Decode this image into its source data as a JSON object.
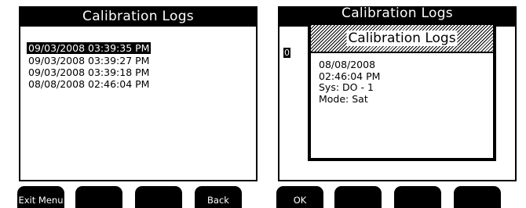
{
  "left_screen": {
    "title": "Calibration Logs",
    "entries": [
      "09/03/2008 03:39:35 PM",
      "09/03/2008 03:39:27 PM",
      "09/03/2008 03:39:18 PM",
      "08/08/2008 02:46:04 PM"
    ],
    "selected_index": 0,
    "softkeys": [
      "Exit Menu",
      "",
      "",
      "Back"
    ]
  },
  "right_screen": {
    "background_title": "Calibration Logs",
    "background_fragment": "0",
    "dialog": {
      "title": "Calibration Logs",
      "lines": [
        "08/08/2008",
        "02:46:04 PM",
        "Sys: DO - 1",
        "Mode: Sat"
      ]
    },
    "softkeys": [
      "OK",
      "",
      "",
      ""
    ]
  }
}
